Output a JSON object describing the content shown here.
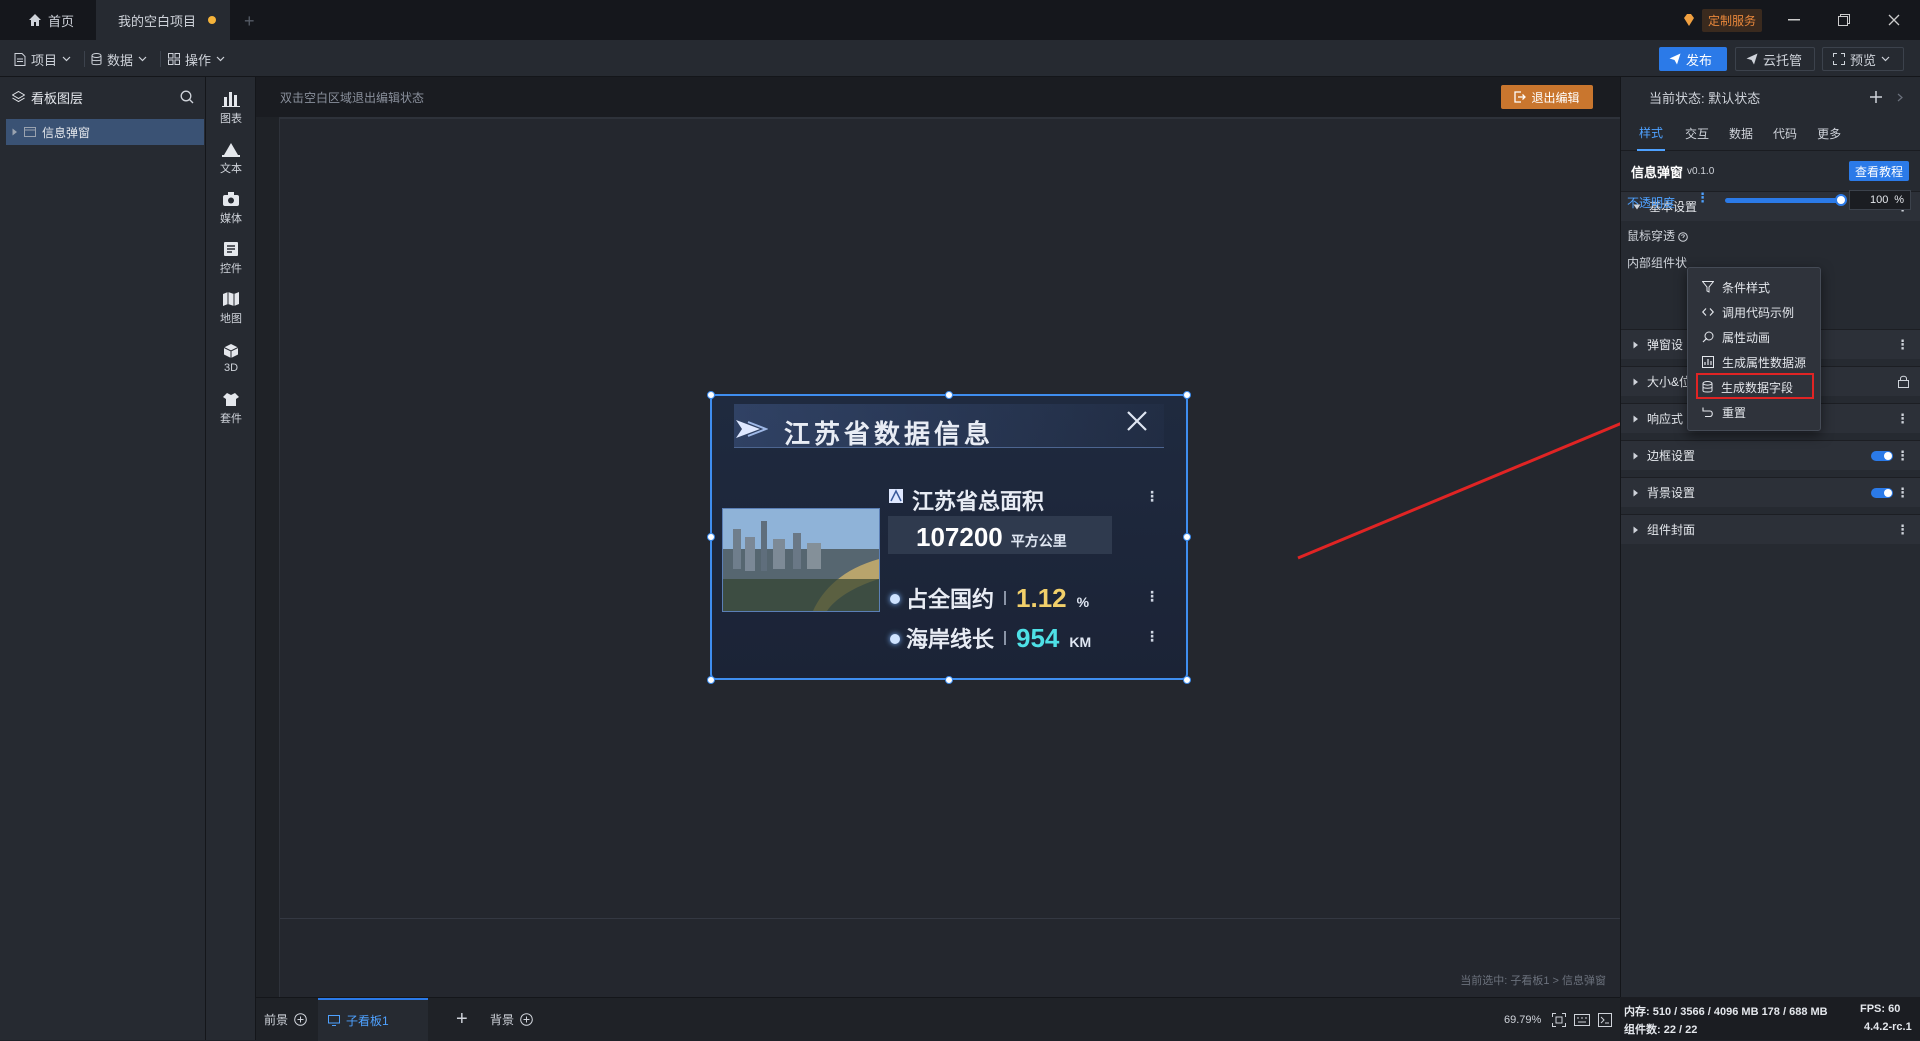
{
  "titlebar": {
    "tabs": [
      {
        "label": "首页",
        "icon": "home-icon"
      },
      {
        "label": "我的空白项目",
        "modified": true
      }
    ],
    "add_tab": "+",
    "custom_service": "定制服务"
  },
  "menubar": {
    "menus": [
      {
        "label": "项目",
        "icon": "document-icon"
      },
      {
        "label": "数据",
        "icon": "database-icon"
      },
      {
        "label": "操作",
        "icon": "grid-icon"
      }
    ],
    "publish": "发布",
    "cloud": "云托管",
    "preview": "预览"
  },
  "layers": {
    "title": "看板图层",
    "items": [
      {
        "label": "信息弹窗"
      }
    ]
  },
  "tools": [
    {
      "label": "图表",
      "icon": "chart-icon"
    },
    {
      "label": "文本",
      "icon": "text-icon"
    },
    {
      "label": "媒体",
      "icon": "media-icon"
    },
    {
      "label": "控件",
      "icon": "control-icon"
    },
    {
      "label": "地图",
      "icon": "map-icon"
    },
    {
      "label": "3D",
      "icon": "cube-icon"
    },
    {
      "label": "套件",
      "icon": "kit-icon"
    }
  ],
  "canvas": {
    "hint": "双击空白区域退出编辑状态",
    "exit_edit": "退出编辑",
    "selected_info": "当前选中: 子看板1 > 信息弹窗"
  },
  "widget": {
    "title": "江苏省数据信息",
    "area_label": "江苏省总面积",
    "area_value": "107200",
    "area_unit": "平方公里",
    "row1_label": "占全国约",
    "row1_value": "1.12",
    "row1_unit": "%",
    "row2_label": "海岸线长",
    "row2_value": "954",
    "row2_unit": "KM"
  },
  "right_panel": {
    "state": "当前状态:  默认状态",
    "tabs": [
      "样式",
      "交互",
      "数据",
      "代码",
      "更多"
    ],
    "component_name": "信息弹窗",
    "component_version": "v0.1.0",
    "tutorial": "查看教程",
    "sections": [
      {
        "label": "基本设置",
        "expanded": true
      },
      {
        "label": "弹窗设"
      },
      {
        "label": "大小&位"
      },
      {
        "label": "响应式"
      },
      {
        "label": "边框设置",
        "toggle": true
      },
      {
        "label": "背景设置",
        "toggle": true
      },
      {
        "label": "组件封面"
      }
    ],
    "props": {
      "opacity_label": "不透明度",
      "opacity_value": "100",
      "opacity_unit": "%",
      "mouse_through": "鼠标穿透",
      "inner_state": "内部组件状"
    }
  },
  "dropdown": {
    "items": [
      {
        "label": "条件样式",
        "icon": "filter-icon"
      },
      {
        "label": "调用代码示例",
        "icon": "code-icon"
      },
      {
        "label": "属性动画",
        "icon": "animation-icon"
      },
      {
        "label": "生成属性数据源",
        "icon": "datasource-icon"
      },
      {
        "label": "生成数据字段",
        "icon": "database-icon",
        "highlighted": true
      },
      {
        "label": "重置",
        "icon": "reset-icon"
      }
    ]
  },
  "bottom": {
    "front": "前景",
    "sub_board": "子看板1",
    "add": "+",
    "background": "背景",
    "zoom": "69.79%"
  },
  "status": {
    "memory": "内存:  510 / 3566 / 4096 MB  178 / 688 MB",
    "fps": "FPS:  60",
    "components": "组件数: 22 / 22",
    "version": "4.4.2-rc.1"
  },
  "colors": {
    "accent": "#2b7ae8",
    "exit_button": "#c9762e",
    "highlight_box": "#e02424",
    "value_yellow": "#f2d06a",
    "value_cyan": "#4ee0e6"
  }
}
